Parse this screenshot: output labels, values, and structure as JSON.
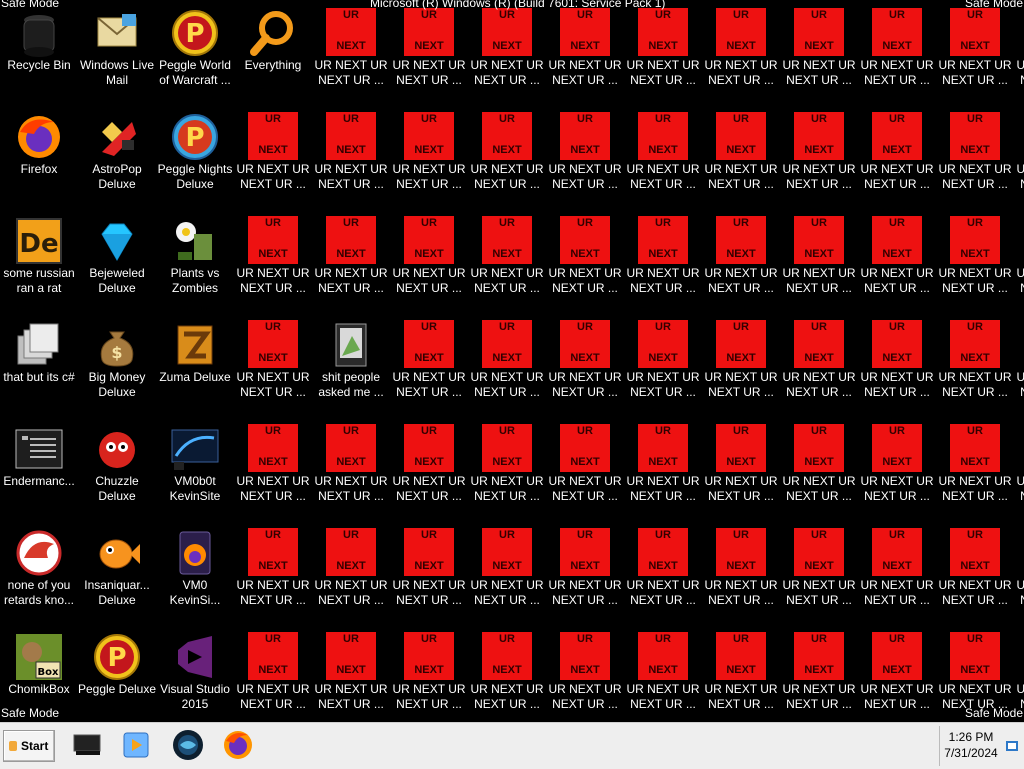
{
  "corners": {
    "safe_mode_tl": "Safe Mode",
    "safe_mode_tr": "Safe Mode",
    "safe_mode_bl": "Safe Mode",
    "safe_mode_br": "Safe Mode",
    "build_text": "Microsoft (R) Windows (R) (Build 7601: Service Pack 1)"
  },
  "tile": {
    "top": "UR",
    "bottom": "NEXT",
    "label_line1": "UR NEXT UR",
    "label_line2": "NEXT UR ...",
    "color": "#ee1111"
  },
  "desktop_icons": [
    {
      "id": "recycle-bin",
      "icon": "recycle-bin-icon",
      "line1": "Recycle Bin",
      "line2": ""
    },
    {
      "id": "windows-live-mail",
      "icon": "windows-live-mail-icon",
      "line1": "Windows Live",
      "line2": "Mail"
    },
    {
      "id": "peggle-world-of-warcraft",
      "icon": "peggle-icon",
      "line1": "Peggle World",
      "line2": "of Warcraft ..."
    },
    {
      "id": "everything",
      "icon": "magnifier-icon",
      "line1": "Everything",
      "line2": ""
    },
    {
      "id": "firefox",
      "icon": "firefox-icon",
      "line1": "Firefox",
      "line2": ""
    },
    {
      "id": "astropop-deluxe",
      "icon": "astropop-icon",
      "line1": "AstroPop",
      "line2": "Deluxe"
    },
    {
      "id": "peggle-nights-deluxe",
      "icon": "peggle-nights-icon",
      "line1": "Peggle Nights",
      "line2": "Deluxe"
    },
    {
      "id": "some-russian-ran-a-rat",
      "icon": "de-icon",
      "line1": "some russian",
      "line2": "ran a rat"
    },
    {
      "id": "bejeweled-deluxe",
      "icon": "diamond-icon",
      "line1": "Bejeweled",
      "line2": "Deluxe"
    },
    {
      "id": "plants-vs-zombies",
      "icon": "plant-icon",
      "line1": "Plants vs",
      "line2": "Zombies"
    },
    {
      "id": "that-but-its-c",
      "icon": "stacked-windows-icon",
      "line1": "that but its c#",
      "line2": ""
    },
    {
      "id": "big-money-deluxe",
      "icon": "money-bag-icon",
      "line1": "Big Money",
      "line2": "Deluxe"
    },
    {
      "id": "zuma-deluxe",
      "icon": "zuma-icon",
      "line1": "Zuma Deluxe",
      "line2": ""
    },
    {
      "id": "shit-people-asked-me",
      "icon": "folder-icon",
      "line1": "shit people",
      "line2": "asked me ..."
    },
    {
      "id": "endermanch",
      "icon": "console-icon",
      "line1": "Endermanc...",
      "line2": ""
    },
    {
      "id": "chuzzle-deluxe",
      "icon": "chuzzle-icon",
      "line1": "Chuzzle",
      "line2": "Deluxe"
    },
    {
      "id": "vm0b0t-kevinsite",
      "icon": "monitor-icon",
      "line1": "VM0b0t",
      "line2": "KevinSite"
    },
    {
      "id": "none-of-you-retards",
      "icon": "red-creature-icon",
      "line1": "none of you",
      "line2": "retards kno..."
    },
    {
      "id": "insaniquarium-deluxe",
      "icon": "fish-icon",
      "line1": "Insaniquar...",
      "line2": "Deluxe"
    },
    {
      "id": "vm0-kevinsi",
      "icon": "firefox-file-icon",
      "line1": "VM0",
      "line2": "KevinSi..."
    },
    {
      "id": "chomikbox",
      "icon": "chomikbox-icon",
      "line1": "ChomikBox",
      "line2": ""
    },
    {
      "id": "peggle-deluxe",
      "icon": "peggle-icon",
      "line1": "Peggle Deluxe",
      "line2": ""
    },
    {
      "id": "visual-studio-2015",
      "icon": "visual-studio-icon",
      "line1": "Visual Studio",
      "line2": "2015"
    }
  ],
  "taskbar": {
    "start_label": "Start",
    "pinned": [
      "computer-icon",
      "media-player-icon",
      "globe-icon",
      "firefox-icon"
    ],
    "time": "1:26 PM",
    "date": "7/31/2024"
  }
}
